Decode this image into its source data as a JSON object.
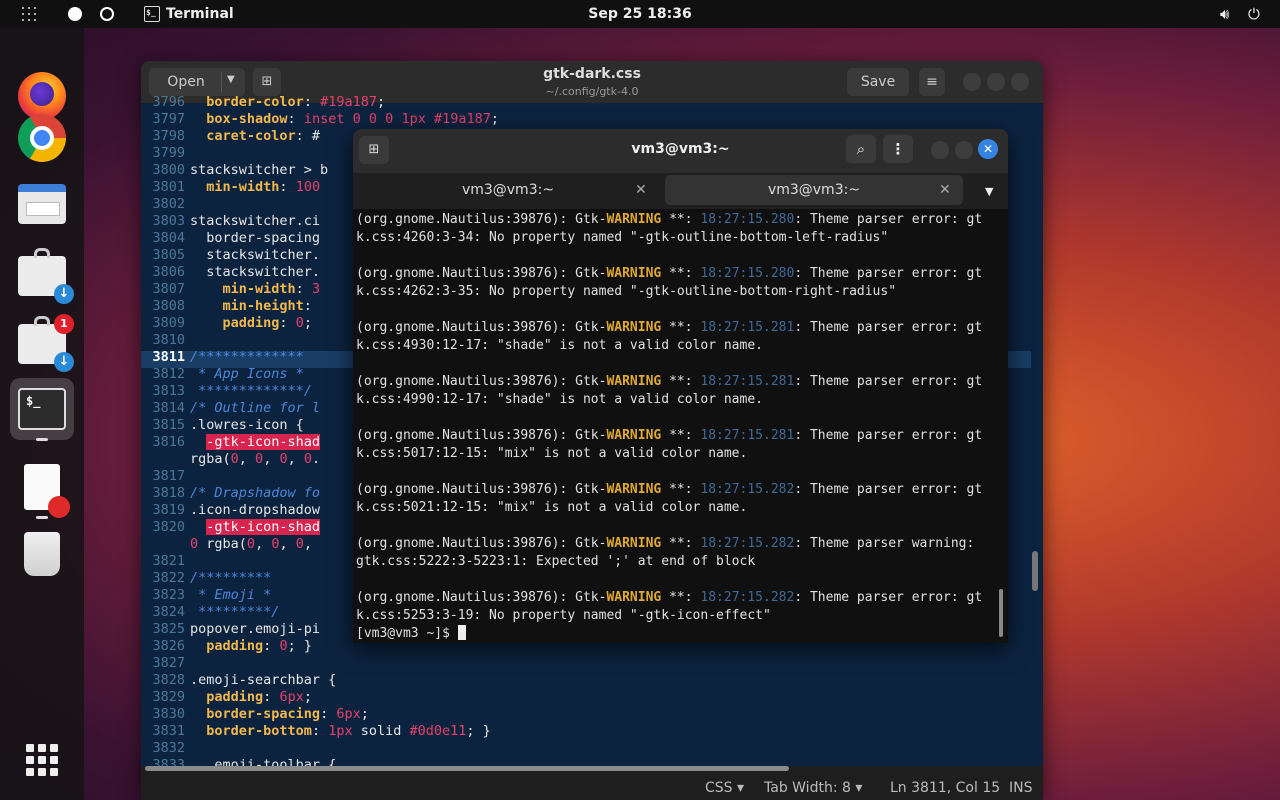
{
  "topbar": {
    "app_name": "Terminal",
    "clock": "Sep 25  18:36",
    "icons": [
      "apps-grid-icon",
      "workspace-indicator-icon",
      "volume-icon",
      "power-icon"
    ]
  },
  "dock": {
    "apps": [
      "firefox",
      "chrome",
      "files",
      "software",
      "software-updates",
      "terminal",
      "text-editor",
      "trash",
      "show-applications"
    ],
    "updates_badge": "1"
  },
  "gedit": {
    "open_label": "Open",
    "save_label": "Save",
    "file_name": "gtk-dark.css",
    "file_path": "~/.config/gtk-4.0",
    "status": {
      "language": "CSS",
      "tab_width": "Tab Width: 8",
      "position": "Ln 3811, Col 15",
      "mode": "INS"
    },
    "lines": [
      {
        "n": "3796",
        "t": "  border-color: #19a187;"
      },
      {
        "n": "3797",
        "t": "  box-shadow: inset 0 0 0 1px #19a187;"
      },
      {
        "n": "3798",
        "t": "  caret-color: #"
      },
      {
        "n": "3799",
        "t": ""
      },
      {
        "n": "3800",
        "t": "stackswitcher > b"
      },
      {
        "n": "3801",
        "t": "  min-width: 100"
      },
      {
        "n": "3802",
        "t": ""
      },
      {
        "n": "3803",
        "t": "stackswitcher.ci"
      },
      {
        "n": "3804",
        "t": "  border-spacing"
      },
      {
        "n": "3805",
        "t": "  stackswitcher."
      },
      {
        "n": "3806",
        "t": "  stackswitcher."
      },
      {
        "n": "3807",
        "t": "    min-width: 3"
      },
      {
        "n": "3808",
        "t": "    min-height: "
      },
      {
        "n": "3809",
        "t": "    padding: 0;"
      },
      {
        "n": "3810",
        "t": ""
      },
      {
        "n": "3811",
        "t": "/*************"
      },
      {
        "n": "3812",
        "t": " * App Icons *"
      },
      {
        "n": "3813",
        "t": " *************/"
      },
      {
        "n": "3814",
        "t": "/* Outline for l"
      },
      {
        "n": "3815",
        "t": ".lowres-icon {"
      },
      {
        "n": "3816",
        "t": "  -gtk-icon-shad"
      },
      {
        "n": "",
        "t": "rgba(0, 0, 0, 0."
      },
      {
        "n": "3817",
        "t": ""
      },
      {
        "n": "3818",
        "t": "/* Drapshadow fo"
      },
      {
        "n": "3819",
        "t": ".icon-dropshadow"
      },
      {
        "n": "3820",
        "t": "  -gtk-icon-shad"
      },
      {
        "n": "",
        "t": "0 rgba(0, 0, 0,"
      },
      {
        "n": "3821",
        "t": ""
      },
      {
        "n": "3822",
        "t": "/*********"
      },
      {
        "n": "3823",
        "t": " * Emoji *"
      },
      {
        "n": "3824",
        "t": " *********/"
      },
      {
        "n": "3825",
        "t": "popover.emoji-pi"
      },
      {
        "n": "3826",
        "t": "  padding: 0; }"
      },
      {
        "n": "3827",
        "t": ""
      },
      {
        "n": "3828",
        "t": ".emoji-searchbar {"
      },
      {
        "n": "3829",
        "t": "  padding: 6px;"
      },
      {
        "n": "3830",
        "t": "  border-spacing: 6px;"
      },
      {
        "n": "3831",
        "t": "  border-bottom: 1px solid #0d0e11; }"
      },
      {
        "n": "3832",
        "t": ""
      },
      {
        "n": "3833",
        "t": "  .emoji-toolbar {"
      }
    ]
  },
  "terminal": {
    "title": "vm3@vm3:~",
    "tabs": [
      {
        "label": "vm3@vm3:~"
      },
      {
        "label": "vm3@vm3:~"
      }
    ],
    "output": [
      {
        "pre": "(org.gnome.Nautilus:39876): Gtk-",
        "lvl": "WARNING",
        "mid": " **: ",
        "ts": "18:27:15.280",
        "post": ": Theme parser error: gt",
        "l2": "k.css:4260:3-34: No property named \"-gtk-outline-bottom-left-radius\""
      },
      {
        "pre": "(org.gnome.Nautilus:39876): Gtk-",
        "lvl": "WARNING",
        "mid": " **: ",
        "ts": "18:27:15.280",
        "post": ": Theme parser error: gt",
        "l2": "k.css:4262:3-35: No property named \"-gtk-outline-bottom-right-radius\""
      },
      {
        "pre": "(org.gnome.Nautilus:39876): Gtk-",
        "lvl": "WARNING",
        "mid": " **: ",
        "ts": "18:27:15.281",
        "post": ": Theme parser error: gt",
        "l2": "k.css:4930:12-17: \"shade\" is not a valid color name."
      },
      {
        "pre": "(org.gnome.Nautilus:39876): Gtk-",
        "lvl": "WARNING",
        "mid": " **: ",
        "ts": "18:27:15.281",
        "post": ": Theme parser error: gt",
        "l2": "k.css:4990:12-17: \"shade\" is not a valid color name."
      },
      {
        "pre": "(org.gnome.Nautilus:39876): Gtk-",
        "lvl": "WARNING",
        "mid": " **: ",
        "ts": "18:27:15.281",
        "post": ": Theme parser error: gt",
        "l2": "k.css:5017:12-15: \"mix\" is not a valid color name."
      },
      {
        "pre": "(org.gnome.Nautilus:39876): Gtk-",
        "lvl": "WARNING",
        "mid": " **: ",
        "ts": "18:27:15.282",
        "post": ": Theme parser error: gt",
        "l2": "k.css:5021:12-15: \"mix\" is not a valid color name."
      },
      {
        "pre": "(org.gnome.Nautilus:39876): Gtk-",
        "lvl": "WARNING",
        "mid": " **: ",
        "ts": "18:27:15.282",
        "post": ": Theme parser warning:",
        "l2": "gtk.css:5222:3-5223:1: Expected ';' at end of block"
      },
      {
        "pre": "(org.gnome.Nautilus:39876): Gtk-",
        "lvl": "WARNING",
        "mid": " **: ",
        "ts": "18:27:15.282",
        "post": ": Theme parser error: gt",
        "l2": "k.css:5253:3-19: No property named \"-gtk-icon-effect\""
      }
    ],
    "prompt": "[vm3@vm3 ~]$ "
  },
  "colors": {
    "accent": "#3584e4",
    "warning": "#e0a92f",
    "editor_bg": "#0c2340",
    "error_highlight": "#d8254f"
  }
}
